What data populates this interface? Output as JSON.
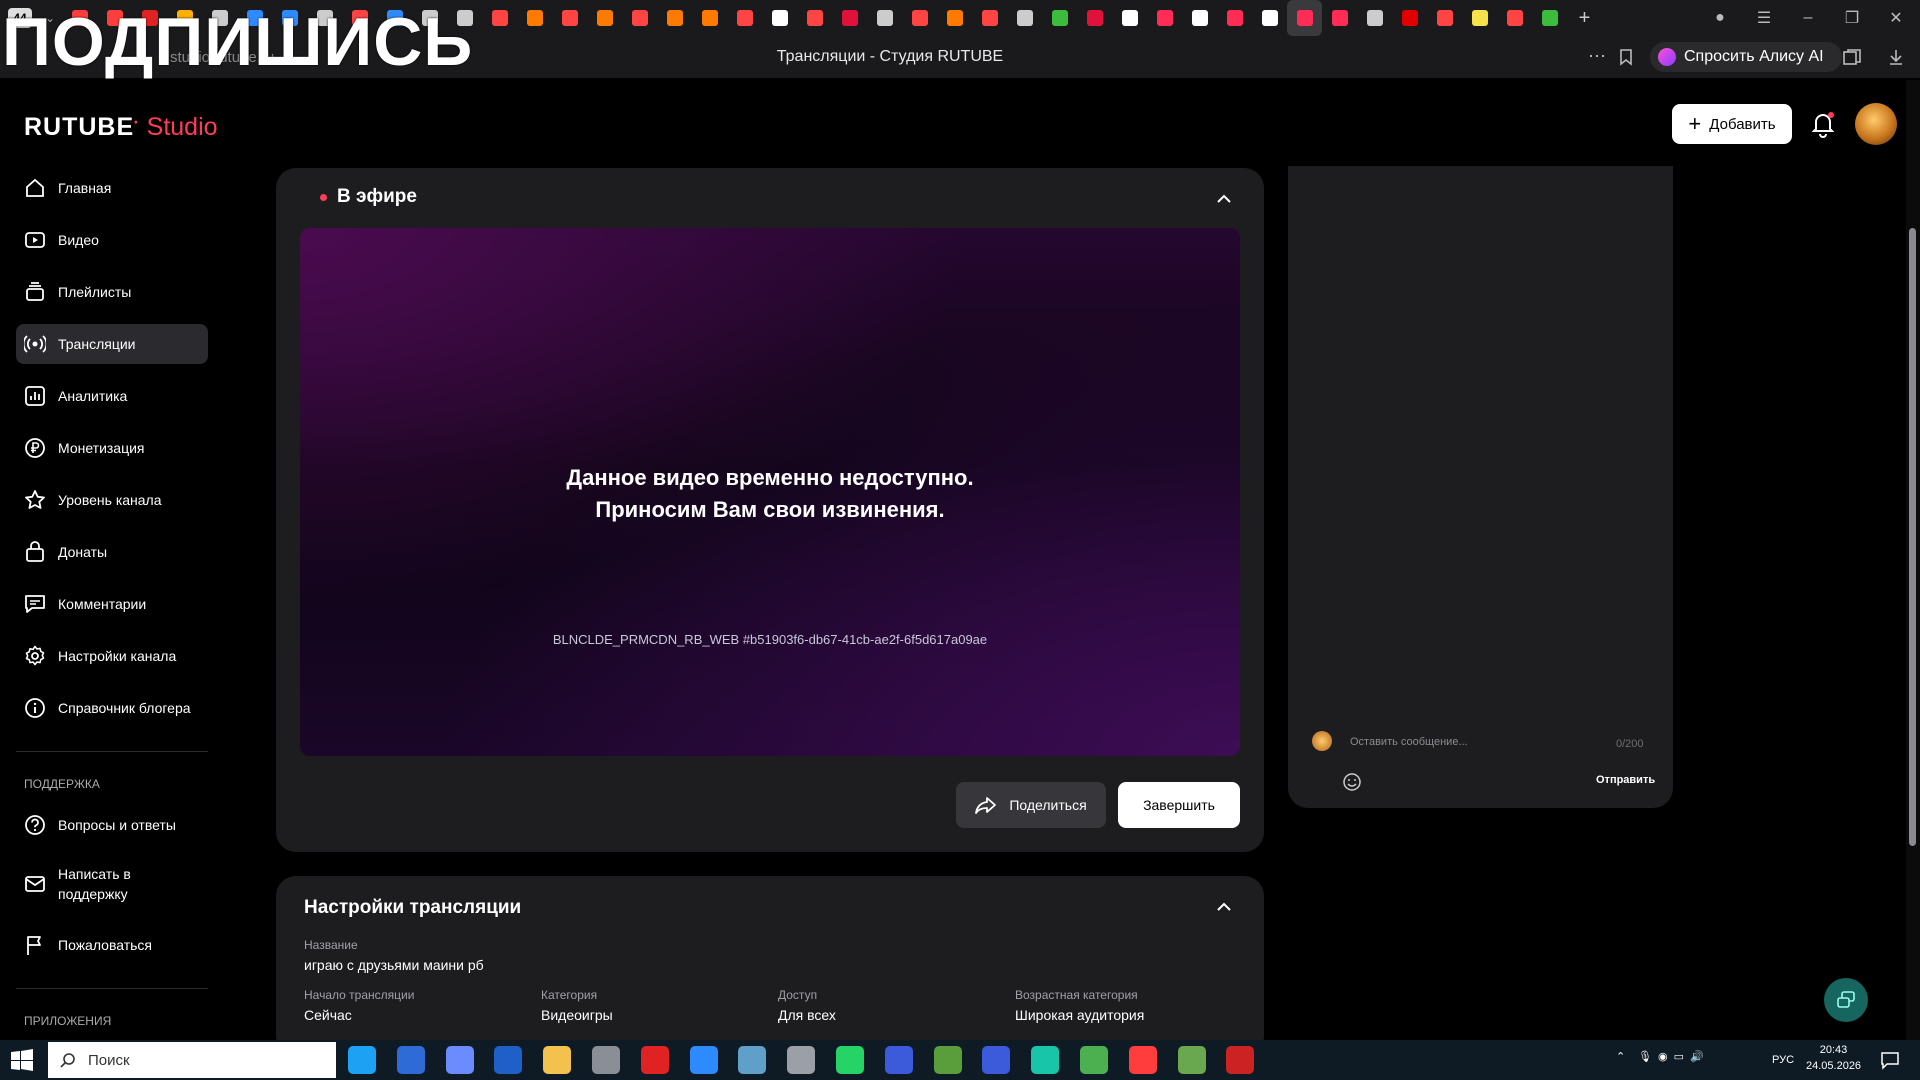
{
  "browser": {
    "tab_count": "44",
    "page_title": "Трансляции - Студия RUTUBE",
    "url": "studio.rutube.ru",
    "alisa_label": "Спросить Алису AI",
    "overlay_text": "ПОДПИШИСЬ",
    "tab_colors": [
      "#ff3d3d",
      "#ff3d3d",
      "#e02222",
      "#ffb000",
      "#cccccc",
      "#2e8bff",
      "#2e8bff",
      "#cccccc",
      "#ff4444",
      "#2e8bff",
      "#cccccc",
      "#cccccc",
      "#ff4444",
      "#ff7a00",
      "#ff4444",
      "#ff7a00",
      "#ff4444",
      "#ff7a00",
      "#ff7a00",
      "#ff4444",
      "#ffffff",
      "#ff4444",
      "#e0113a",
      "#cccccc",
      "#ff4444",
      "#ff7a00",
      "#ff4444",
      "#cccccc",
      "#3dbb3d",
      "#e0113a",
      "#ffffff",
      "#ff2d55",
      "#ffffff",
      "#ff2d55",
      "#ffffff",
      "#ff2d55",
      "#ff2d55",
      "#cccccc",
      "#e00000",
      "#ff4444",
      "#f5e14b",
      "#ff4444",
      "#3dbb3d"
    ]
  },
  "header": {
    "logo_main": "RUTUBE",
    "logo_sub": "Studio",
    "add_label": "Добавить"
  },
  "sidebar": {
    "items": [
      {
        "label": "Главная",
        "icon": "home-icon"
      },
      {
        "label": "Видео",
        "icon": "video-icon"
      },
      {
        "label": "Плейлисты",
        "icon": "playlist-icon"
      },
      {
        "label": "Трансляции",
        "icon": "broadcast-icon",
        "active": true
      },
      {
        "label": "Аналитика",
        "icon": "analytics-icon"
      },
      {
        "label": "Монетизация",
        "icon": "ruble-icon"
      },
      {
        "label": "Уровень канала",
        "icon": "star-icon"
      },
      {
        "label": "Донаты",
        "icon": "donate-icon"
      },
      {
        "label": "Комментарии",
        "icon": "comment-icon"
      },
      {
        "label": "Настройки канала",
        "icon": "gear-icon"
      },
      {
        "label": "Справочник блогера",
        "icon": "info-icon"
      }
    ],
    "support_heading": "ПОДДЕРЖКА",
    "support_items": [
      {
        "label": "Вопросы и ответы",
        "icon": "question-icon"
      },
      {
        "label": "Написать в поддержку",
        "icon": "mail-icon"
      },
      {
        "label": "Пожаловаться",
        "icon": "flag-icon"
      }
    ],
    "apps_heading": "ПРИЛОЖЕНИЯ"
  },
  "live": {
    "title": "В эфире",
    "error_line1": "Данное видео временно недоступно.",
    "error_line2": "Приносим Вам свои извинения.",
    "error_code": "BLNCLDE_PRMCDN_RB_WEB #b51903f6-db67-41cb-ae2f-6f5d617a09ae",
    "share_label": "Поделиться",
    "end_label": "Завершить"
  },
  "chat": {
    "placeholder": "Оставить сообщение...",
    "counter": "0/200",
    "send_label": "Отправить"
  },
  "settings": {
    "title": "Настройки трансляции",
    "name_label": "Название",
    "name_value": "играю с друзьями маини рб",
    "fields": [
      {
        "label": "Начало трансляции",
        "value": "Сейчас"
      },
      {
        "label": "Категория",
        "value": "Видеоигры"
      },
      {
        "label": "Доступ",
        "value": "Для всех"
      },
      {
        "label": "Возрастная категория",
        "value": "Широкая аудитория"
      }
    ]
  },
  "taskbar": {
    "search_placeholder": "Поиск",
    "lang": "РУС",
    "time": "20:43",
    "date": "24.05.2026",
    "app_colors": [
      "#1da1f2",
      "#2f6bd6",
      "#6b8cff",
      "#1f5fc8",
      "#f2c14e",
      "#8a8f96",
      "#e02222",
      "#2e8bff",
      "#5fa0c8",
      "#9aa0a6",
      "#25d366",
      "#3b5bdb",
      "#5a9e3c",
      "#3b5bdb",
      "#18c5a8",
      "#4caf50",
      "#ff3d3d",
      "#6aa84f",
      "#cc2222"
    ]
  }
}
